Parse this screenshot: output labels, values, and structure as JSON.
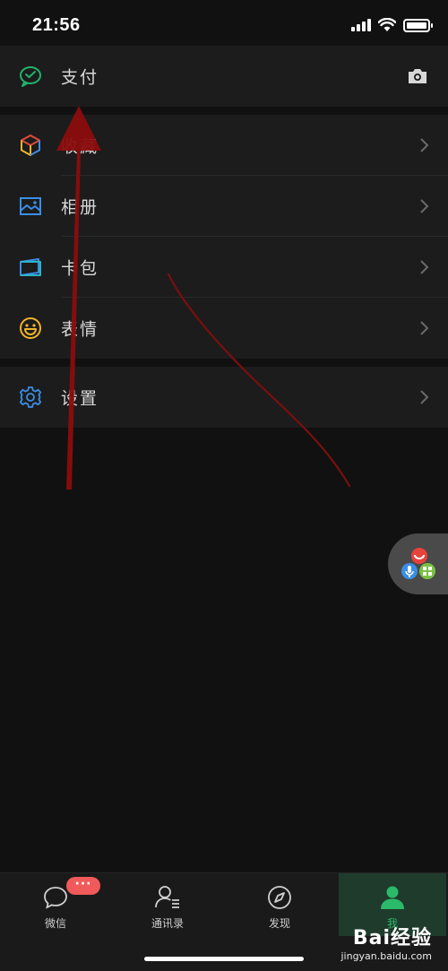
{
  "status_bar": {
    "time": "21:56",
    "signal_icon": "cellular-signal-icon",
    "wifi_icon": "wifi-icon",
    "battery_icon": "battery-full-icon",
    "battery_level": 1.0
  },
  "menu": {
    "pay": {
      "label": "支付",
      "icon": "wechat-pay-icon",
      "camera_icon": "camera-icon",
      "color": "#21b46a"
    },
    "items": [
      {
        "label": "收藏",
        "icon": "favorites-cube-icon"
      },
      {
        "label": "相册",
        "icon": "album-picture-icon"
      },
      {
        "label": "卡包",
        "icon": "card-wallet-icon"
      },
      {
        "label": "表情",
        "icon": "sticker-smile-icon"
      }
    ],
    "settings": {
      "label": "设置",
      "icon": "settings-gear-icon"
    }
  },
  "floating_widget": {
    "icon": "floating-assistant-icon"
  },
  "tab_bar": {
    "tabs": [
      {
        "label": "微信",
        "icon": "chat-bubble-icon",
        "badge": "···"
      },
      {
        "label": "通讯录",
        "icon": "contacts-icon"
      },
      {
        "label": "发现",
        "icon": "discover-compass-icon"
      },
      {
        "label": "我",
        "icon": "me-person-icon",
        "active": true
      }
    ],
    "active_color": "#2bb96a"
  },
  "watermark": {
    "main": "Bai经验",
    "sub": "jingyan.baidu.com"
  },
  "colors": {
    "background": "#111111",
    "row": "#1c1c1c",
    "accent_green": "#21b46a",
    "annotation_red": "#8b0d0d",
    "badge_red": "#f05a5a"
  }
}
